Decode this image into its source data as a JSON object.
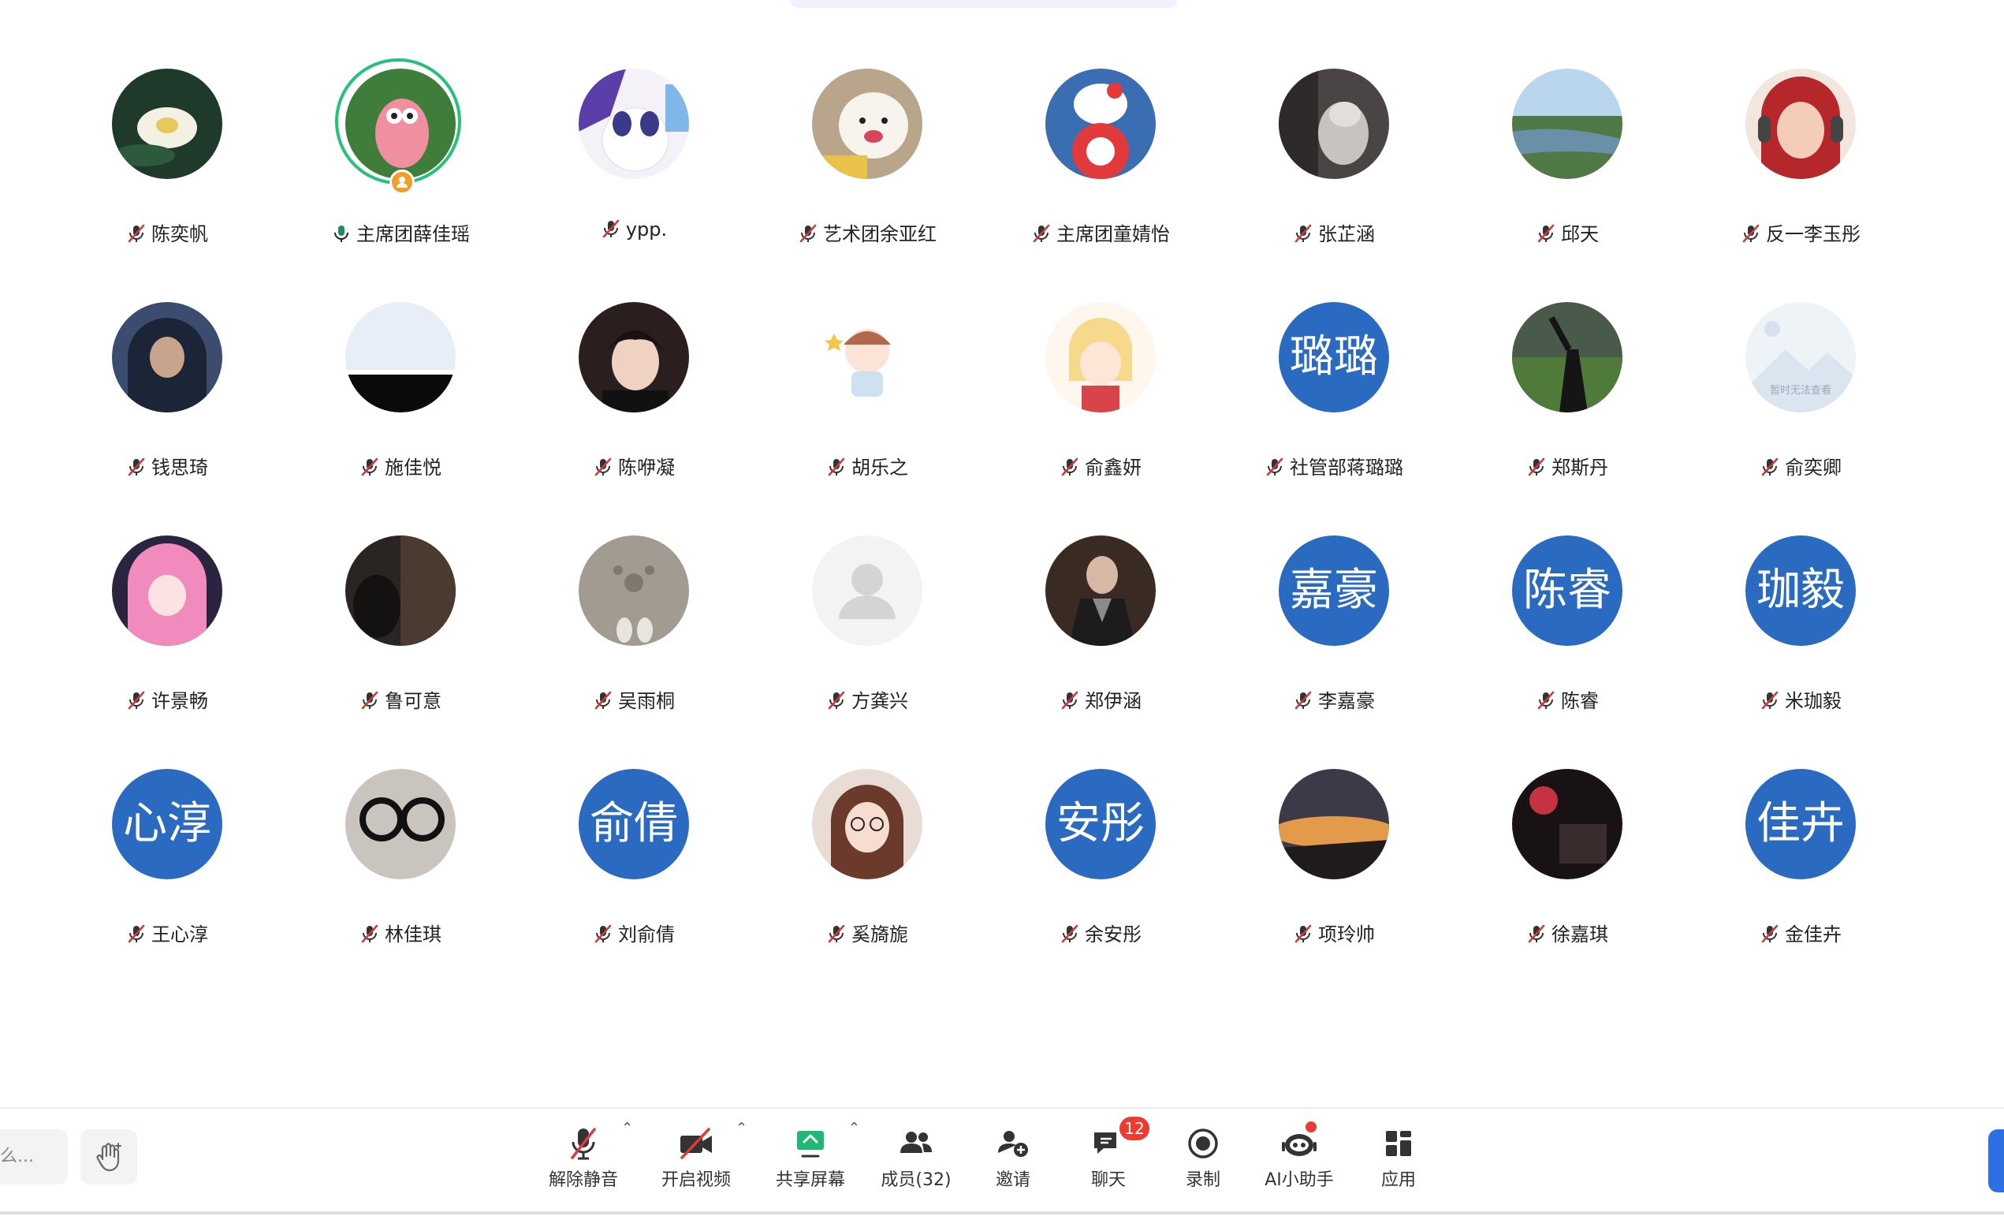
{
  "participants": [
    {
      "name": "陈奕帆",
      "mic": "muted",
      "avatar": {
        "kind": "photo",
        "scene": "lotus"
      }
    },
    {
      "name": "主席团薛佳瑶",
      "mic": "speaking",
      "host": true,
      "avatar": {
        "kind": "photo",
        "scene": "cartoon-star"
      }
    },
    {
      "name": "ypp.",
      "mic": "muted",
      "avatar": {
        "kind": "photo",
        "scene": "pony"
      }
    },
    {
      "name": "艺术团余亚红",
      "mic": "muted",
      "avatar": {
        "kind": "photo",
        "scene": "dog"
      }
    },
    {
      "name": "主席团童婧怡",
      "mic": "muted",
      "avatar": {
        "kind": "photo",
        "scene": "kitty"
      }
    },
    {
      "name": "张芷涵",
      "mic": "muted",
      "avatar": {
        "kind": "photo",
        "scene": "cat"
      }
    },
    {
      "name": "邱天",
      "mic": "muted",
      "avatar": {
        "kind": "photo",
        "scene": "landscape"
      }
    },
    {
      "name": "反一李玉彤",
      "mic": "muted",
      "avatar": {
        "kind": "photo",
        "scene": "redhair"
      }
    },
    {
      "name": "钱思琦",
      "mic": "muted",
      "avatar": {
        "kind": "photo",
        "scene": "hoodie"
      }
    },
    {
      "name": "施佳悦",
      "mic": "muted",
      "avatar": {
        "kind": "photo",
        "scene": "sky-black"
      }
    },
    {
      "name": "陈咿凝",
      "mic": "muted",
      "avatar": {
        "kind": "photo",
        "scene": "boy"
      }
    },
    {
      "name": "胡乐之",
      "mic": "muted",
      "avatar": {
        "kind": "photo",
        "scene": "chibi"
      }
    },
    {
      "name": "俞鑫妍",
      "mic": "muted",
      "avatar": {
        "kind": "photo",
        "scene": "anime-blonde"
      }
    },
    {
      "name": "社管部蒋璐璐",
      "mic": "muted",
      "avatar": {
        "kind": "letters",
        "text": "璐璐"
      }
    },
    {
      "name": "郑斯丹",
      "mic": "muted",
      "avatar": {
        "kind": "photo",
        "scene": "field"
      }
    },
    {
      "name": "俞奕卿",
      "mic": "muted",
      "avatar": {
        "kind": "photo",
        "scene": "placeholder",
        "caption": "暂时无法查看"
      }
    },
    {
      "name": "许景畅",
      "mic": "muted",
      "avatar": {
        "kind": "photo",
        "scene": "pink-hood"
      }
    },
    {
      "name": "鲁可意",
      "mic": "muted",
      "avatar": {
        "kind": "photo",
        "scene": "dark-room"
      }
    },
    {
      "name": "吴雨桐",
      "mic": "muted",
      "avatar": {
        "kind": "photo",
        "scene": "paw"
      }
    },
    {
      "name": "方龚兴",
      "mic": "muted",
      "avatar": {
        "kind": "photo",
        "scene": "default"
      }
    },
    {
      "name": "郑伊涵",
      "mic": "muted",
      "avatar": {
        "kind": "photo",
        "scene": "man-coat"
      }
    },
    {
      "name": "李嘉豪",
      "mic": "muted",
      "avatar": {
        "kind": "letters",
        "text": "嘉豪"
      }
    },
    {
      "name": "陈睿",
      "mic": "muted",
      "avatar": {
        "kind": "letters",
        "text": "陈睿"
      }
    },
    {
      "name": "米珈毅",
      "mic": "muted",
      "avatar": {
        "kind": "letters",
        "text": "珈毅"
      }
    },
    {
      "name": "王心淳",
      "mic": "muted",
      "avatar": {
        "kind": "letters",
        "text": "心淳"
      }
    },
    {
      "name": "林佳琪",
      "mic": "muted",
      "avatar": {
        "kind": "photo",
        "scene": "glasses"
      }
    },
    {
      "name": "刘俞倩",
      "mic": "muted",
      "avatar": {
        "kind": "letters",
        "text": "俞倩"
      }
    },
    {
      "name": "奚旖旎",
      "mic": "muted",
      "avatar": {
        "kind": "photo",
        "scene": "girl-glasses"
      }
    },
    {
      "name": "余安彤",
      "mic": "muted",
      "avatar": {
        "kind": "letters",
        "text": "安彤"
      }
    },
    {
      "name": "项玲帅",
      "mic": "muted",
      "avatar": {
        "kind": "photo",
        "scene": "sunset"
      }
    },
    {
      "name": "徐嘉琪",
      "mic": "muted",
      "avatar": {
        "kind": "photo",
        "scene": "night-car"
      }
    },
    {
      "name": "金佳卉",
      "mic": "muted",
      "avatar": {
        "kind": "letters",
        "text": "佳卉"
      }
    }
  ],
  "toolbar": {
    "chat_placeholder": "么...",
    "unmute": "解除静音",
    "start_video": "开启视频",
    "share_screen": "共享屏幕",
    "members": "成员(32)",
    "invite": "邀请",
    "chat": "聊天",
    "chat_badge": "12",
    "record": "录制",
    "ai_assistant": "AI小助手",
    "apps": "应用"
  },
  "colors": {
    "letter_avatar": "#2a6bc1",
    "speaking_ring": "#24c27a",
    "muted_icon": "#d23a3a",
    "accent": "#2f6fe4"
  }
}
